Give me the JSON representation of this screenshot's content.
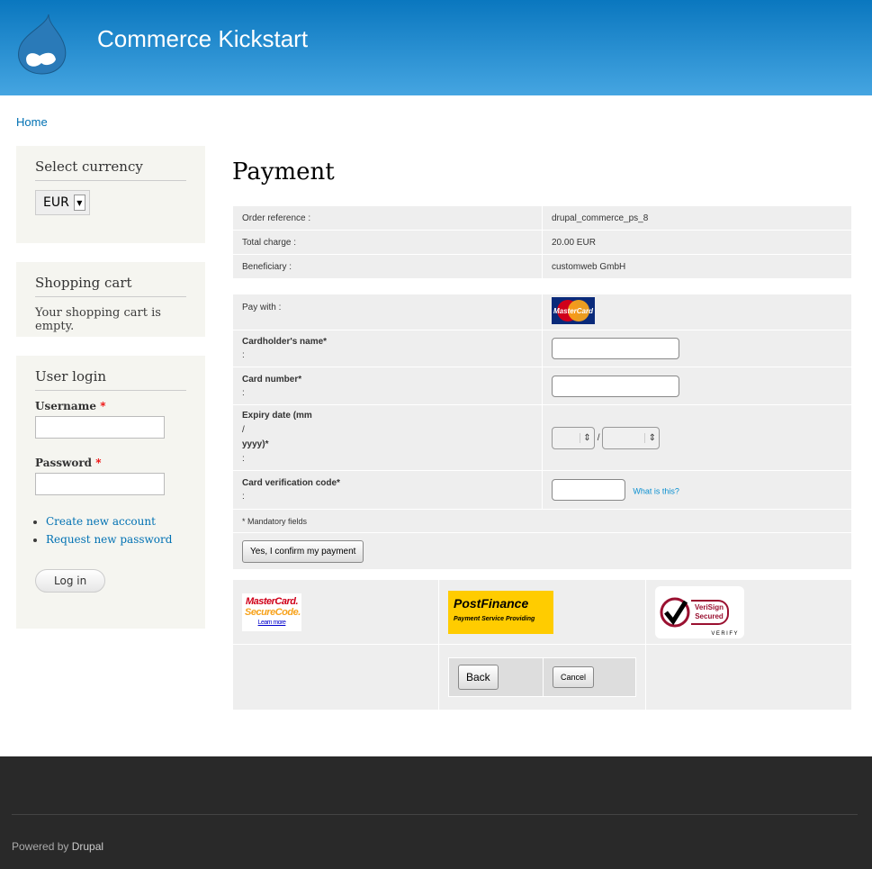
{
  "header": {
    "site_name": "Commerce Kickstart"
  },
  "breadcrumb": {
    "home": "Home"
  },
  "sidebar": {
    "currency": {
      "title": "Select currency",
      "value": "EUR"
    },
    "cart": {
      "title": "Shopping cart",
      "text": "Your shopping cart is empty."
    },
    "login": {
      "title": "User login",
      "username_label": "Username",
      "password_label": "Password",
      "required": "*",
      "create_account": "Create new account",
      "request_password": "Request new password",
      "login_button": "Log in"
    }
  },
  "main": {
    "title": "Payment",
    "info": [
      {
        "label": "Order reference :",
        "value": "drupal_commerce_ps_8"
      },
      {
        "label": "Total charge :",
        "value": "20.00 EUR"
      },
      {
        "label": "Beneficiary :",
        "value": "customweb GmbH"
      }
    ],
    "form": {
      "pay_with": "Pay with :",
      "card_logo": "MasterCard",
      "cardholder": "Cardholder's name*",
      "card_number": "Card number*",
      "expiry_1": "Expiry date (mm",
      "expiry_2": "/",
      "expiry_3": "yyyy)*",
      "colon": ":",
      "separator": "/",
      "cvc": "Card verification code*",
      "what_is_this": "What is this?",
      "mandatory": "* Mandatory fields",
      "confirm": "Yes, I confirm my payment"
    },
    "logos": {
      "mastercard_1": "MasterCard.",
      "mastercard_2": "SecureCode.",
      "learn_more": "Learn more",
      "postfinance": "PostFinance",
      "postfinance_sub": "Payment Service Providing",
      "verisign_1": "VeriSign",
      "verisign_2": "Secured",
      "verify": "VERIFY"
    },
    "back": "Back",
    "cancel": "Cancel"
  },
  "footer": {
    "powered": "Powered by ",
    "drupal": "Drupal"
  }
}
